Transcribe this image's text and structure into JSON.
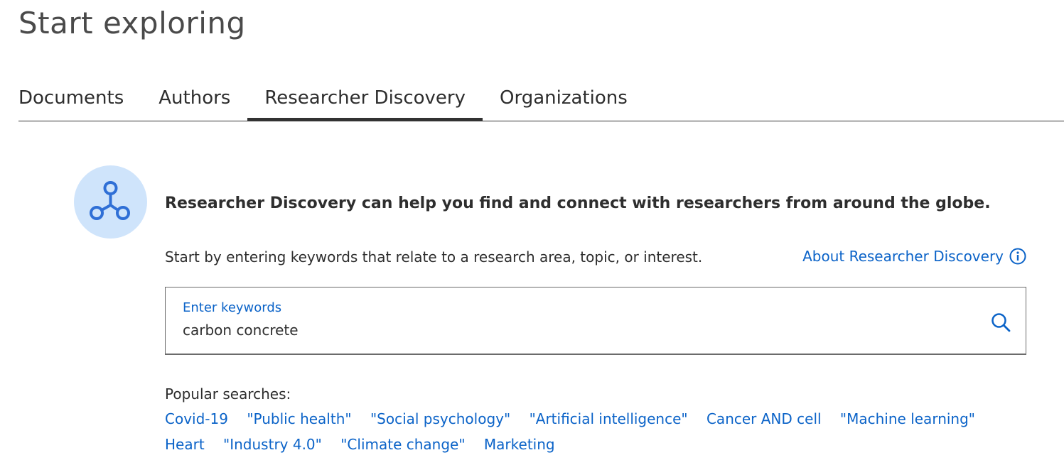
{
  "page": {
    "title": "Start exploring"
  },
  "tabs": [
    {
      "label": "Documents",
      "active": false
    },
    {
      "label": "Authors",
      "active": false
    },
    {
      "label": "Researcher Discovery",
      "active": true
    },
    {
      "label": "Organizations",
      "active": false
    }
  ],
  "researcher_discovery": {
    "icon": "network-nodes-icon",
    "intro": "Researcher Discovery can help you find and connect with researchers from around the globe.",
    "hint": "Start by entering keywords that relate to a research area, topic, or interest.",
    "about_link": "About Researcher Discovery",
    "about_icon": "info-icon"
  },
  "search": {
    "label": "Enter keywords",
    "value": "carbon concrete",
    "icon": "search-icon"
  },
  "popular": {
    "label": "Popular searches:",
    "row1": [
      "Covid-19",
      "\"Public health\"",
      "\"Social psychology\"",
      "\"Artificial intelligence\"",
      "Cancer AND cell",
      "\"Machine learning\""
    ],
    "row2": [
      "Heart",
      "\"Industry 4.0\"",
      "\"Climate change\"",
      "Marketing"
    ]
  },
  "colors": {
    "link": "#0b63c8",
    "icon_bg": "#cfe4fb",
    "text": "#2e2e2e"
  }
}
